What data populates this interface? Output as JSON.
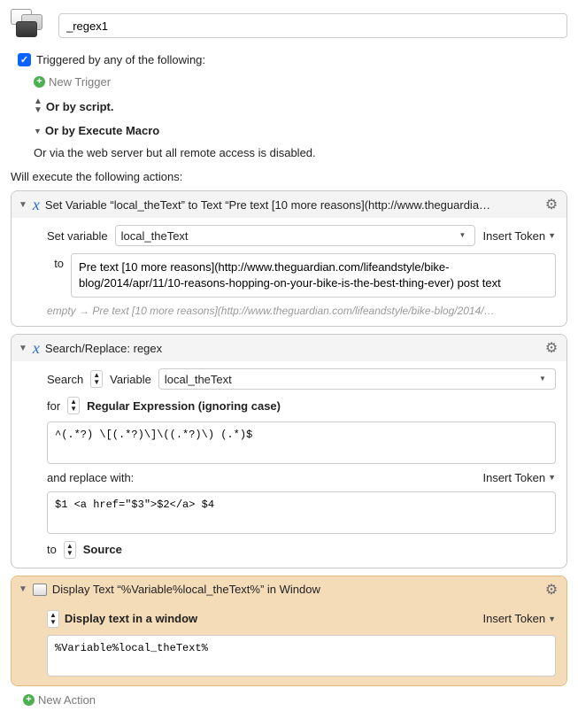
{
  "header": {
    "macro_name": "_regex1"
  },
  "triggers": {
    "checkbox_label": "Triggered by any of the following:",
    "new_trigger": "New Trigger",
    "or_script": "Or by script.",
    "or_execute": "Or by Execute Macro",
    "or_web": "Or via the web server but all remote access is disabled."
  },
  "exec_label": "Will execute the following actions:",
  "insert_token": "Insert Token",
  "action1": {
    "title": "Set Variable “local_theText” to Text “Pre text [10 more reasons](http://www.theguardia…",
    "set_variable_label": "Set variable",
    "variable_name": "local_theText",
    "to_label": "to",
    "to_value": "Pre text [10 more reasons](http://www.theguardian.com/lifeandstyle/bike-blog/2014/apr/11/10-reasons-hopping-on-your-bike-is-the-best-thing-ever) post text",
    "preview_empty": "empty",
    "preview_rest": "Pre text [10 more reasons](http://www.theguardian.com/lifeandstyle/bike-blog/2014/…"
  },
  "action2": {
    "title": "Search/Replace: regex",
    "search_label": "Search",
    "variable_label": "Variable",
    "variable_name": "local_theText",
    "for_label": "for",
    "for_type": "Regular Expression (ignoring case)",
    "pattern": "^(.*?) \\[(.*?)\\]\\((.*?)\\) (.*)$",
    "replace_label": "and replace with:",
    "replace_value": "$1 <a href=\"$3\">$2</a> $4",
    "to_label": "to",
    "to_target": "Source"
  },
  "action3": {
    "title": "Display Text “%Variable%local_theText%” in Window",
    "mode": "Display text in a window",
    "value": "%Variable%local_theText%"
  },
  "new_action": "New Action"
}
